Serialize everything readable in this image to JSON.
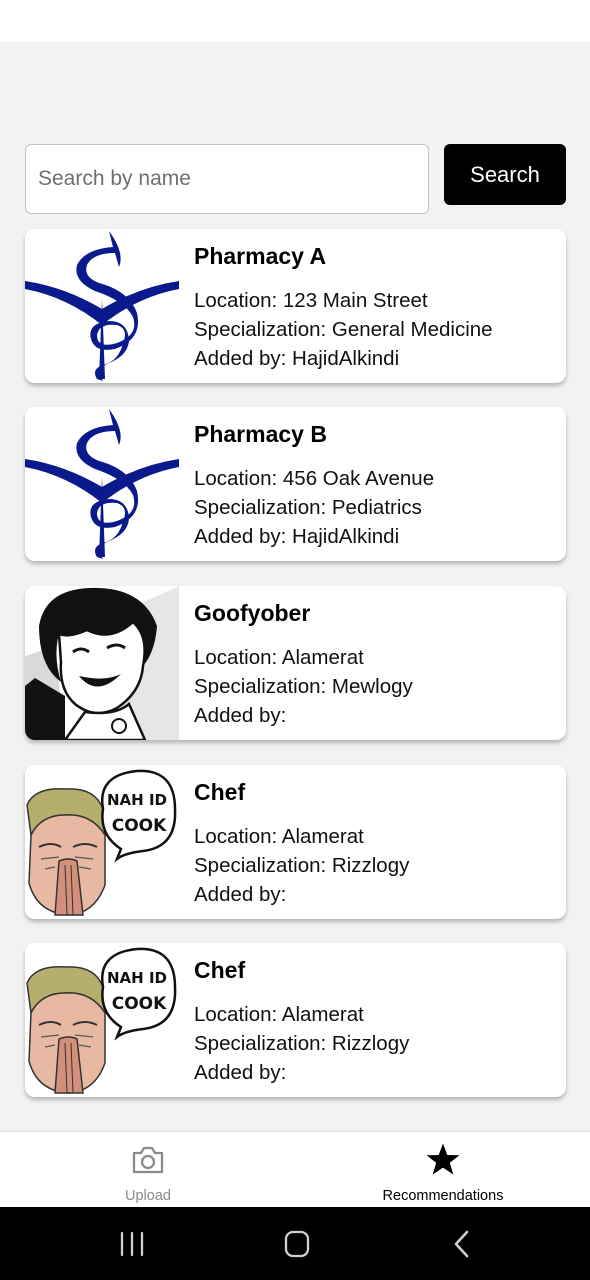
{
  "search": {
    "placeholder": "Search by name",
    "value": "",
    "button_label": "Search"
  },
  "cards": [
    {
      "title": "Pharmacy A",
      "location": "Location: 123 Main Street",
      "specialization": "Specialization: General Medicine",
      "added_by": "Added by: HajidAlkindi",
      "image": "pharmacy-symbol"
    },
    {
      "title": "Pharmacy B",
      "location": "Location: 456 Oak Avenue",
      "specialization": "Specialization: Pediatrics",
      "added_by": "Added by: HajidAlkindi",
      "image": "pharmacy-symbol"
    },
    {
      "title": "Goofyober",
      "location": "Location: Alamerat",
      "specialization": "Specialization: Mewlogy",
      "added_by": "Added by:",
      "image": "manga-character"
    },
    {
      "title": "Chef",
      "location": "Location: Alamerat",
      "specialization": "Specialization: Rizzlogy",
      "added_by": "Added by:",
      "image": "chef-meme",
      "speech_text": "NAH ID COOK"
    },
    {
      "title": "Chef",
      "location": "Location: Alamerat",
      "specialization": "Specialization: Rizzlogy",
      "added_by": "Added by:",
      "image": "chef-meme",
      "speech_text": "NAH ID COOK"
    }
  ],
  "nav": {
    "upload": {
      "label": "Upload",
      "icon": "camera-icon",
      "active": false
    },
    "recommendations": {
      "label": "Recommendations",
      "icon": "star-icon",
      "active": true
    }
  },
  "system_nav": {
    "icons": [
      "recents-icon",
      "home-icon",
      "back-icon"
    ]
  },
  "colors": {
    "accent": "#000000",
    "pharmacy_symbol": "#0a1a8c",
    "background": "#f2f2f2",
    "inactive": "#8a8a8a"
  }
}
